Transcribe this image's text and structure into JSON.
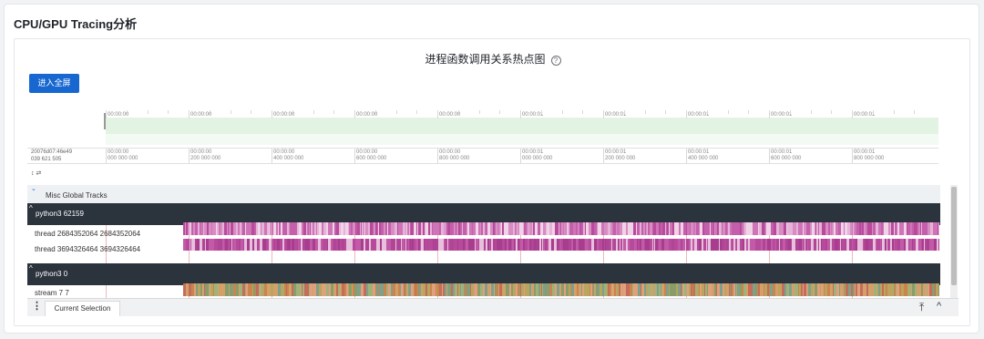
{
  "page": {
    "title": "CPU/GPU Tracing分析"
  },
  "chart": {
    "title": "进程函数调用关系热点图",
    "help_icon": "?"
  },
  "toolbar": {
    "fullscreen_label": "进入全屏"
  },
  "timeline": {
    "left_timestamp_top": "20076d07:46e49",
    "left_timestamp_bottom": "039 621 505",
    "minimap_ticks": [
      "00:00:00",
      "00:00:00",
      "00:00:00",
      "00:00:00",
      "00:00:00",
      "00:00:01",
      "00:00:01",
      "00:00:01",
      "00:00:01",
      "00:00:01"
    ],
    "ruler_ticks_top": [
      "00:00:00",
      "00:00:00",
      "00:00:00",
      "00:00:00",
      "00:00:00",
      "00:00:01",
      "00:00:01",
      "00:00:01",
      "00:00:01",
      "00:00:01"
    ],
    "ruler_ticks_bottom": [
      "000 000 000",
      "200 000 000",
      "400 000 000",
      "600 000 000",
      "800 000 000",
      "000 000 000",
      "200 000 000",
      "400 000 000",
      "600 000 000",
      "800 000 000"
    ],
    "small_icons": "↕ ⇄"
  },
  "tracks": {
    "misc_label": "Misc Global Tracks",
    "process1": {
      "name": "python3 62159",
      "threads": [
        "thread 2684352064 2684352064",
        "thread 3694326464 3694326464"
      ]
    },
    "process2": {
      "name": "python3 0",
      "threads": [
        "stream 7 7"
      ]
    }
  },
  "bottom": {
    "current_selection_label": "Current Selection"
  },
  "colors": {
    "accent": "#1767d0",
    "header_bg": "#2b333d",
    "heat_pink": "#b84a9c",
    "heat_light": "#d88cc2"
  }
}
